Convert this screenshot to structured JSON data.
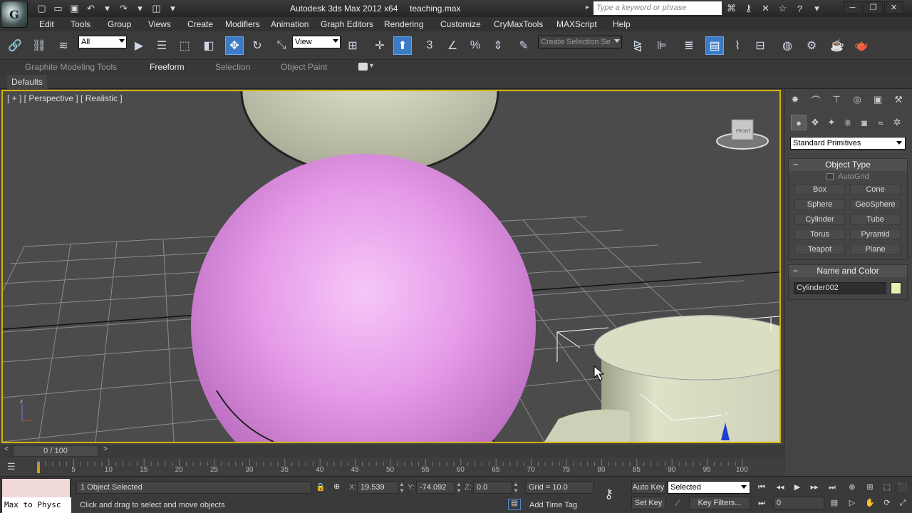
{
  "app": {
    "title": "Autodesk 3ds Max  2012 x64",
    "file": "teaching.max",
    "logo_glyph": "G",
    "search_placeholder": "Type a keyword or phrase"
  },
  "menus": [
    "Edit",
    "Tools",
    "Group",
    "Views",
    "Create",
    "Modifiers",
    "Animation",
    "Graph Editors",
    "Rendering",
    "Customize",
    "CryMaxTools",
    "MAXScript",
    "Help"
  ],
  "toolbar": {
    "selection_filter": "All",
    "ref_coord": "View",
    "selection_set_placeholder": "Create Selection Se"
  },
  "ribbon": {
    "tabs": [
      "Graphite Modeling Tools",
      "Freeform",
      "Selection",
      "Object Paint"
    ],
    "active_tab": "Freeform",
    "defaults_label": "Defaults"
  },
  "viewport": {
    "label": "[ + ] [ Perspective ] [ Realistic ]",
    "viewcube_face": "FRONT",
    "gizmo_axis": "z",
    "world_axis": "z",
    "colors": {
      "sphere": "#e59be8",
      "head": "#d6d8c1",
      "cylinder": "#e0e2c8",
      "active_border": "#d4b300"
    }
  },
  "command_panel": {
    "dropdown": "Standard Primitives",
    "object_type": {
      "title": "Object Type",
      "autogrid": "AutoGrid",
      "buttons": [
        "Box",
        "Cone",
        "Sphere",
        "GeoSphere",
        "Cylinder",
        "Tube",
        "Torus",
        "Pyramid",
        "Teapot",
        "Plane"
      ]
    },
    "name_and_color": {
      "title": "Name and Color",
      "name": "Cylinder002",
      "color": "#e2f2b1"
    }
  },
  "timeline": {
    "frame_display": "0 / 100",
    "ticks": [
      "5",
      "10",
      "15",
      "20",
      "25",
      "30",
      "35",
      "40",
      "45",
      "50",
      "55",
      "60",
      "65",
      "70",
      "75",
      "80",
      "85",
      "90",
      "95",
      "100"
    ]
  },
  "status": {
    "maxscript_text": "Max to Physc",
    "selection_status": "1 Object Selected",
    "prompt": "Click and drag to select and move objects",
    "x_label": "X:",
    "x": "19.539",
    "y_label": "Y:",
    "y": "-74.092",
    "z_label": "Z:",
    "z": "0.0",
    "grid": "Grid = 10.0",
    "add_time_tag": "Add Time Tag",
    "auto_key": "Auto Key",
    "set_key": "Set Key",
    "key_mode": "Selected",
    "key_filters": "Key Filters...",
    "current_frame": "0"
  }
}
